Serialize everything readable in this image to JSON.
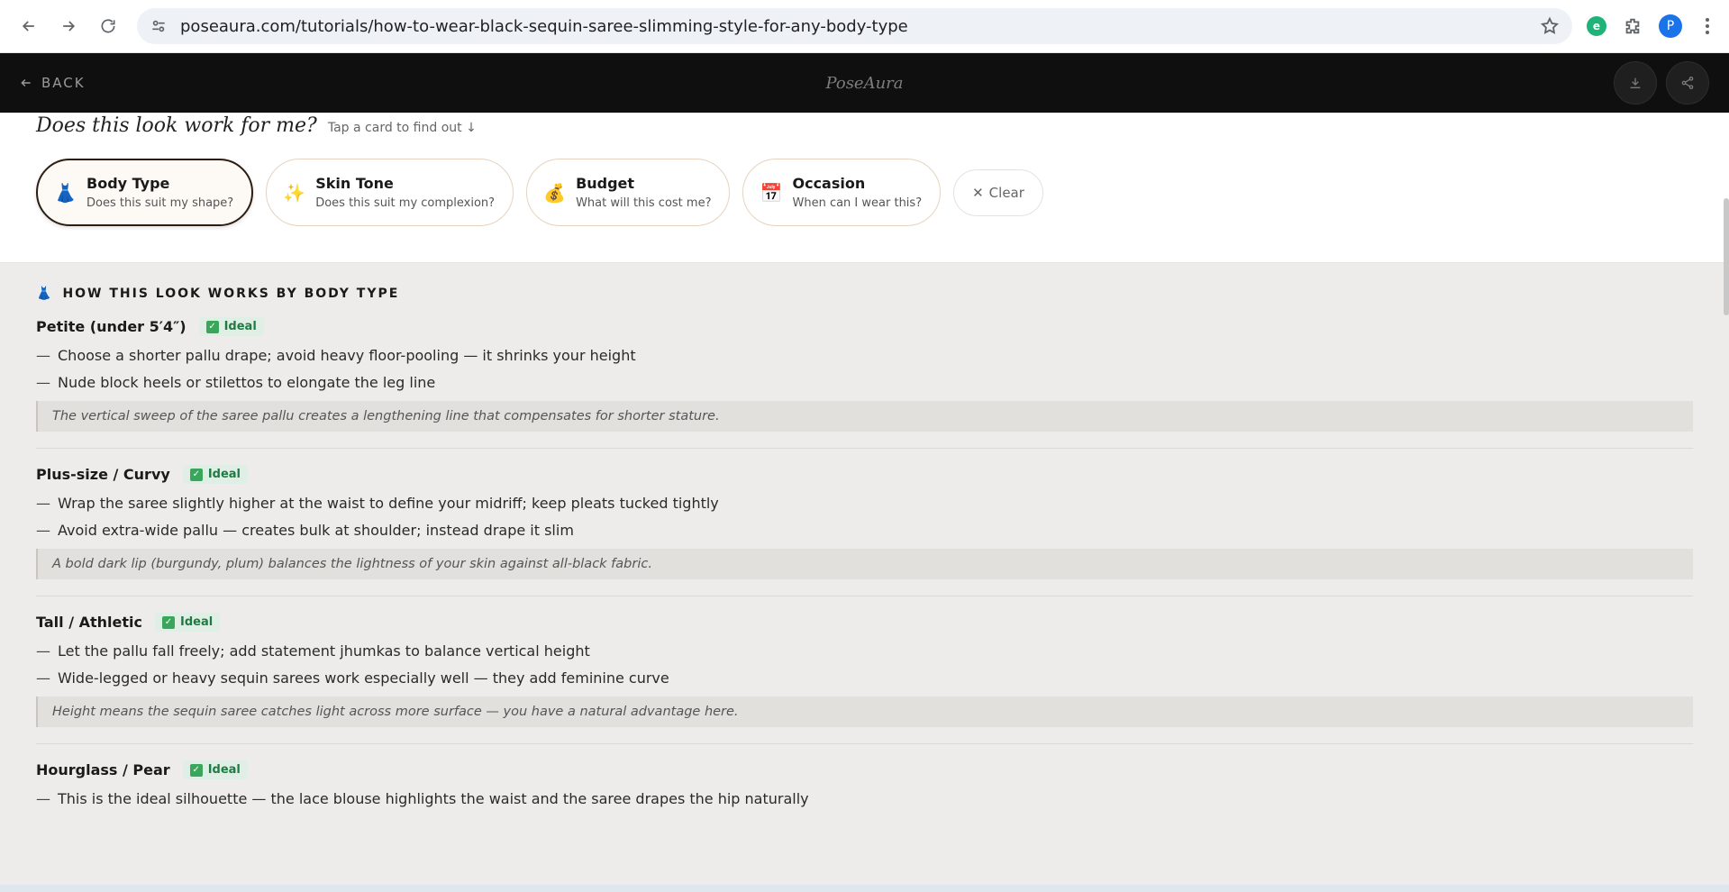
{
  "browser": {
    "url": "poseaura.com/tutorials/how-to-wear-black-sequin-saree-slimming-style-for-any-body-type",
    "profile_initial": "P"
  },
  "site": {
    "back_label": "BACK",
    "brand": "PoseAura"
  },
  "filter": {
    "question": "Does this look work for me?",
    "hint": "Tap a card to find out ↓",
    "cards": [
      {
        "emoji": "👗",
        "title": "Body Type",
        "subtitle": "Does this suit my shape?"
      },
      {
        "emoji": "✨",
        "title": "Skin Tone",
        "subtitle": "Does this suit my complexion?"
      },
      {
        "emoji": "💰",
        "title": "Budget",
        "subtitle": "What will this cost me?"
      },
      {
        "emoji": "📅",
        "title": "Occasion",
        "subtitle": "When can I wear this?"
      }
    ],
    "clear_label": "Clear"
  },
  "content": {
    "heading_icon": "👗",
    "heading": "HOW THIS LOOK WORKS BY BODY TYPE",
    "body_types": [
      {
        "name": "Petite (under 5′4″)",
        "badge": "Ideal",
        "tips": [
          "Choose a shorter pallu drape; avoid heavy floor-pooling — it shrinks your height",
          "Nude block heels or stilettos to elongate the leg line"
        ],
        "note": "The vertical sweep of the saree pallu creates a lengthening line that compensates for shorter stature."
      },
      {
        "name": "Plus-size / Curvy",
        "badge": "Ideal",
        "tips": [
          "Wrap the saree slightly higher at the waist to define your midriff; keep pleats tucked tightly",
          "Avoid extra-wide pallu — creates bulk at shoulder; instead drape it slim"
        ],
        "note": "A bold dark lip (burgundy, plum) balances the lightness of your skin against all-black fabric."
      },
      {
        "name": "Tall / Athletic",
        "badge": "Ideal",
        "tips": [
          "Let the pallu fall freely; add statement jhumkas to balance vertical height",
          "Wide-legged or heavy sequin sarees work especially well — they add feminine curve"
        ],
        "note": "Height means the sequin saree catches light across more surface — you have a natural advantage here."
      },
      {
        "name": "Hourglass / Pear",
        "badge": "Ideal",
        "tips": [
          "This is the ideal silhouette — the lace blouse highlights the waist and the saree drapes the hip naturally"
        ],
        "note": ""
      }
    ]
  }
}
